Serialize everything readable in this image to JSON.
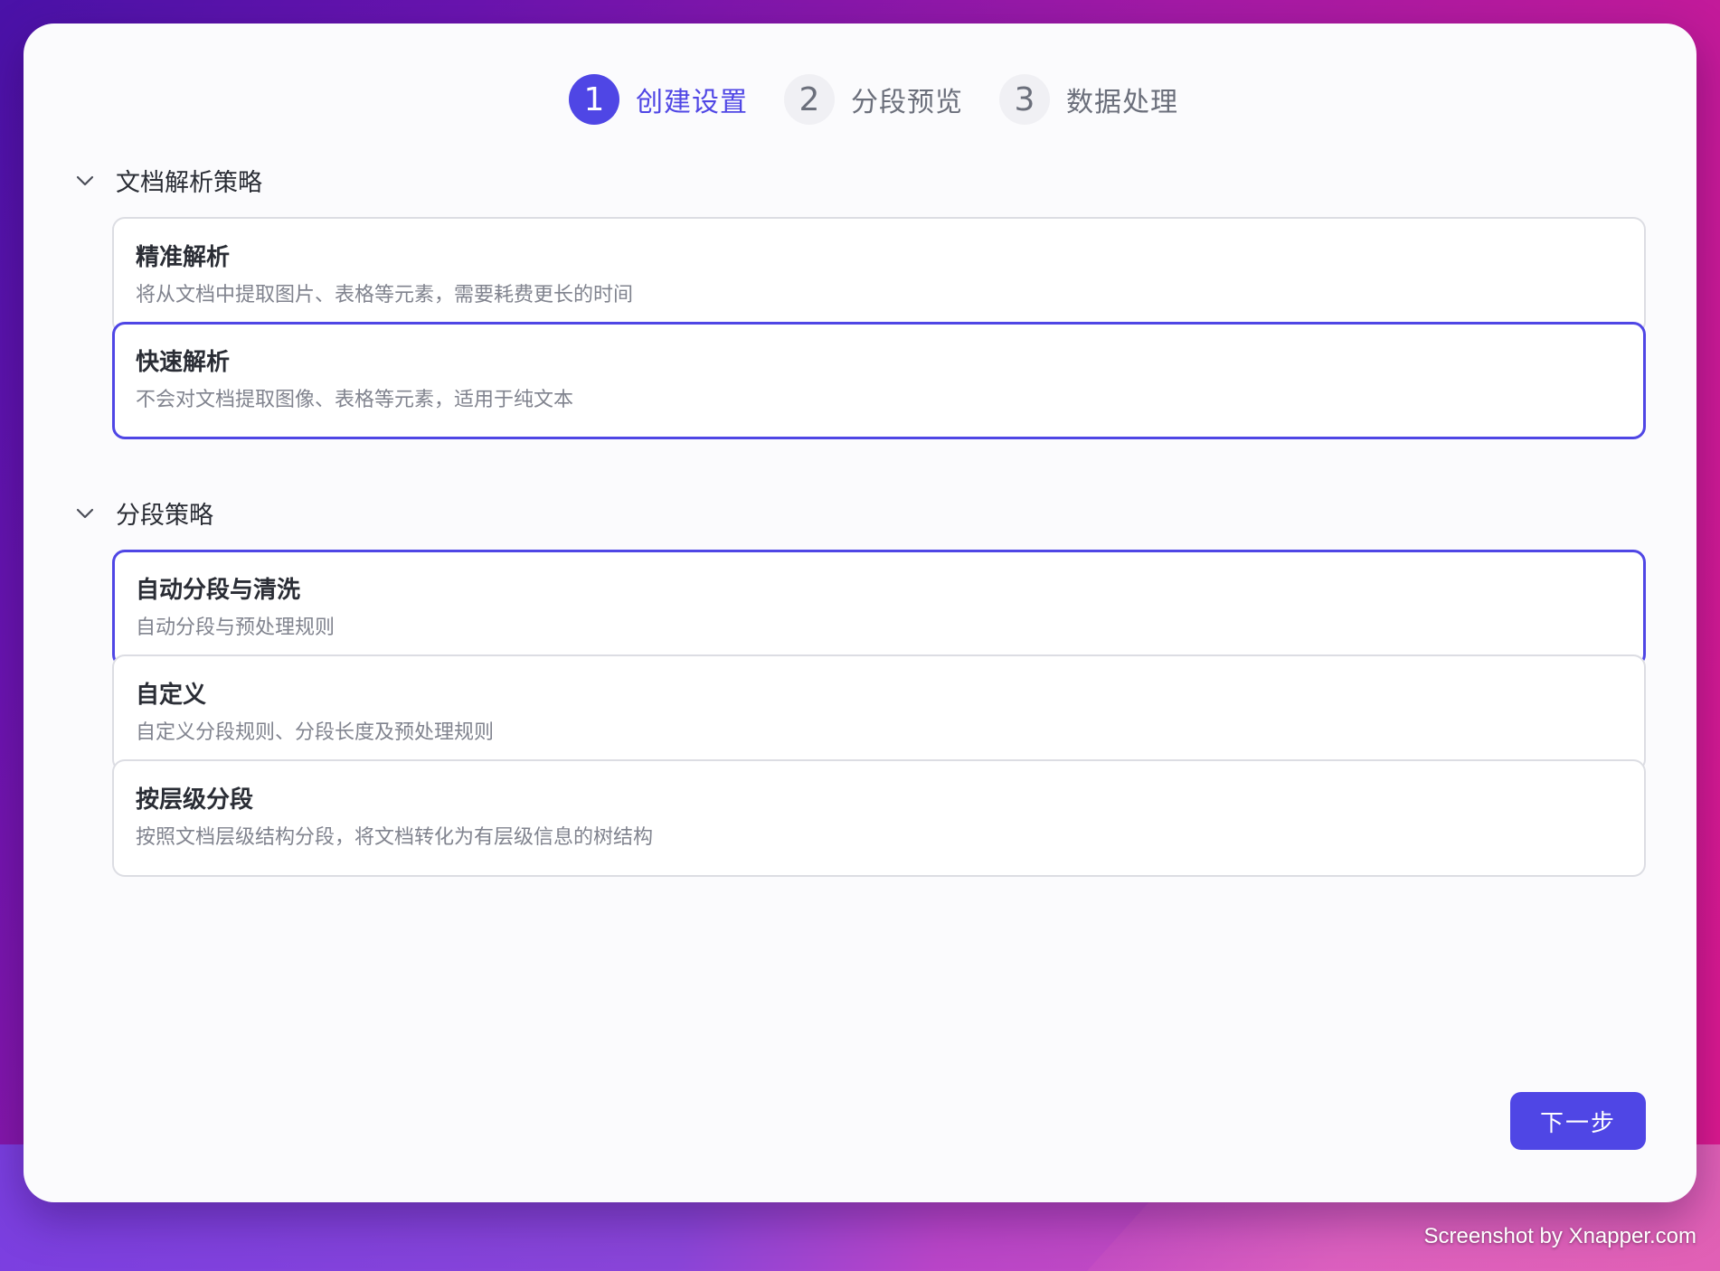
{
  "steps": [
    {
      "number": "1",
      "label": "创建设置",
      "active": true
    },
    {
      "number": "2",
      "label": "分段预览",
      "active": false
    },
    {
      "number": "3",
      "label": "数据处理",
      "active": false
    }
  ],
  "sections": [
    {
      "title": "文档解析策略",
      "icon": "chevron-down-icon",
      "options": [
        {
          "title": "精准解析",
          "description": "将从文档中提取图片、表格等元素，需要耗费更长的时间",
          "selected": false
        },
        {
          "title": "快速解析",
          "description": "不会对文档提取图像、表格等元素，适用于纯文本",
          "selected": true
        }
      ]
    },
    {
      "title": "分段策略",
      "icon": "chevron-down-icon",
      "options": [
        {
          "title": "自动分段与清洗",
          "description": "自动分段与预处理规则",
          "selected": true
        },
        {
          "title": "自定义",
          "description": "自定义分段规则、分段长度及预处理规则",
          "selected": false
        },
        {
          "title": "按层级分段",
          "description": "按照文档层级结构分段，将文档转化为有层级信息的树结构",
          "selected": false
        }
      ]
    }
  ],
  "actions": {
    "next_label": "下一步"
  },
  "watermark": "Screenshot by Xnapper.com",
  "colors": {
    "accent": "#4f46e5",
    "border": "#dcdde3",
    "text_primary": "#2a2d35",
    "text_secondary": "#80838e"
  }
}
